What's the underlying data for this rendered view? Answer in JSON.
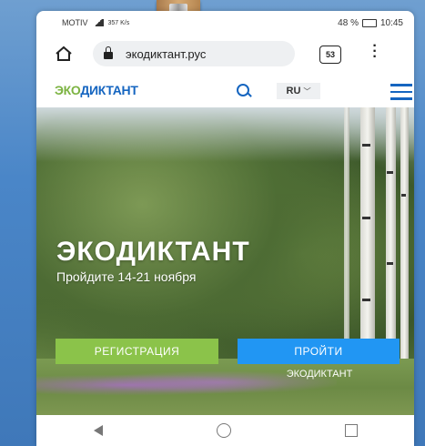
{
  "status_bar": {
    "carrier": "MOTIV",
    "speed": "357 K/s",
    "battery": "48 %",
    "time": "10:45"
  },
  "browser": {
    "url": "экодиктант.рус",
    "tab_count": "53"
  },
  "site_header": {
    "logo_part1": "ЭКО",
    "logo_part2": "ДИКТАНТ",
    "language": "RU"
  },
  "hero": {
    "title": "ЭКОДИКТАНТ",
    "subtitle": "Пройдите 14-21 ноября",
    "register_label": "РЕГИСТРАЦИЯ",
    "start_label": "ПРОЙТИ",
    "start_sublabel": "ЭКОДИКТАНТ"
  },
  "icons": {
    "home": "home-icon",
    "lock": "lock-icon",
    "menu": "more-vert-icon",
    "search": "search-icon",
    "hamburger": "hamburger-menu-icon",
    "nav_back": "back-icon",
    "nav_home": "circle-home-icon",
    "nav_recent": "square-recent-icon"
  },
  "colors": {
    "logo_green": "#7cb342",
    "logo_blue": "#1565c0",
    "register_button": "#8bc34a",
    "start_button": "#2196f3"
  }
}
